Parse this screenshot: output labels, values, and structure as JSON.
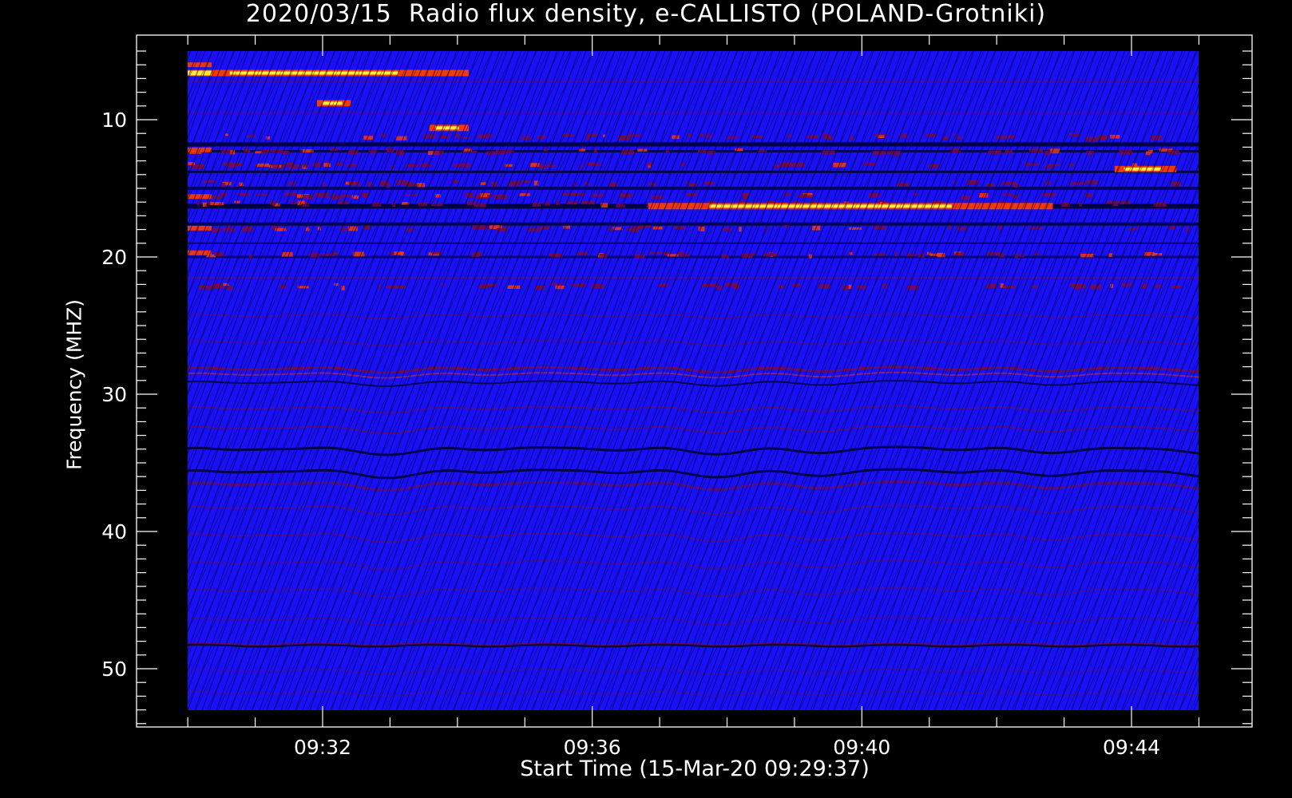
{
  "chart_data": {
    "type": "heatmap",
    "title": "2020/03/15  Radio flux density, e-CALLISTO (POLAND-Grotniki)",
    "xlabel": "Start Time (15-Mar-20 09:29:37)",
    "ylabel": "Frequency (MHZ)",
    "x_start": "09:29:37",
    "x_end": "09:44:40",
    "xlim_minutes": [
      9.62,
      24.67
    ],
    "ylim": [
      55,
      5
    ],
    "data_extent_y": [
      5,
      53
    ],
    "y_ticks": [
      10,
      20,
      30,
      40,
      50
    ],
    "x_ticks": [
      "09:32",
      "09:36",
      "09:40",
      "09:44"
    ],
    "x_tick_minutes": [
      32,
      36,
      40,
      44
    ],
    "colormap": {
      "background": "#1a10f5",
      "dark": "#000030",
      "mid": "#7a0a40",
      "high": "#ff3c00",
      "peak": "#ffff40"
    },
    "bright_features": [
      {
        "label": "band ~6.5 MHz",
        "t_start": "09:29:37",
        "t_end": "09:34:10",
        "freq_mhz": 6.6
      },
      {
        "label": "burst ~9 MHz",
        "t_start": "09:31:55",
        "t_end": "09:32:25",
        "freq_mhz": 8.8
      },
      {
        "label": "burst ~10.5 MHz",
        "t_start": "09:33:35",
        "t_end": "09:34:10",
        "freq_mhz": 10.6
      },
      {
        "label": "band ~16.3 MHz",
        "t_start": "09:36:50",
        "t_end": "09:42:50",
        "freq_mhz": 16.3
      },
      {
        "label": "band ~13.5 MHz",
        "t_start": "09:43:45",
        "t_end": "09:44:40",
        "freq_mhz": 13.6
      }
    ]
  }
}
